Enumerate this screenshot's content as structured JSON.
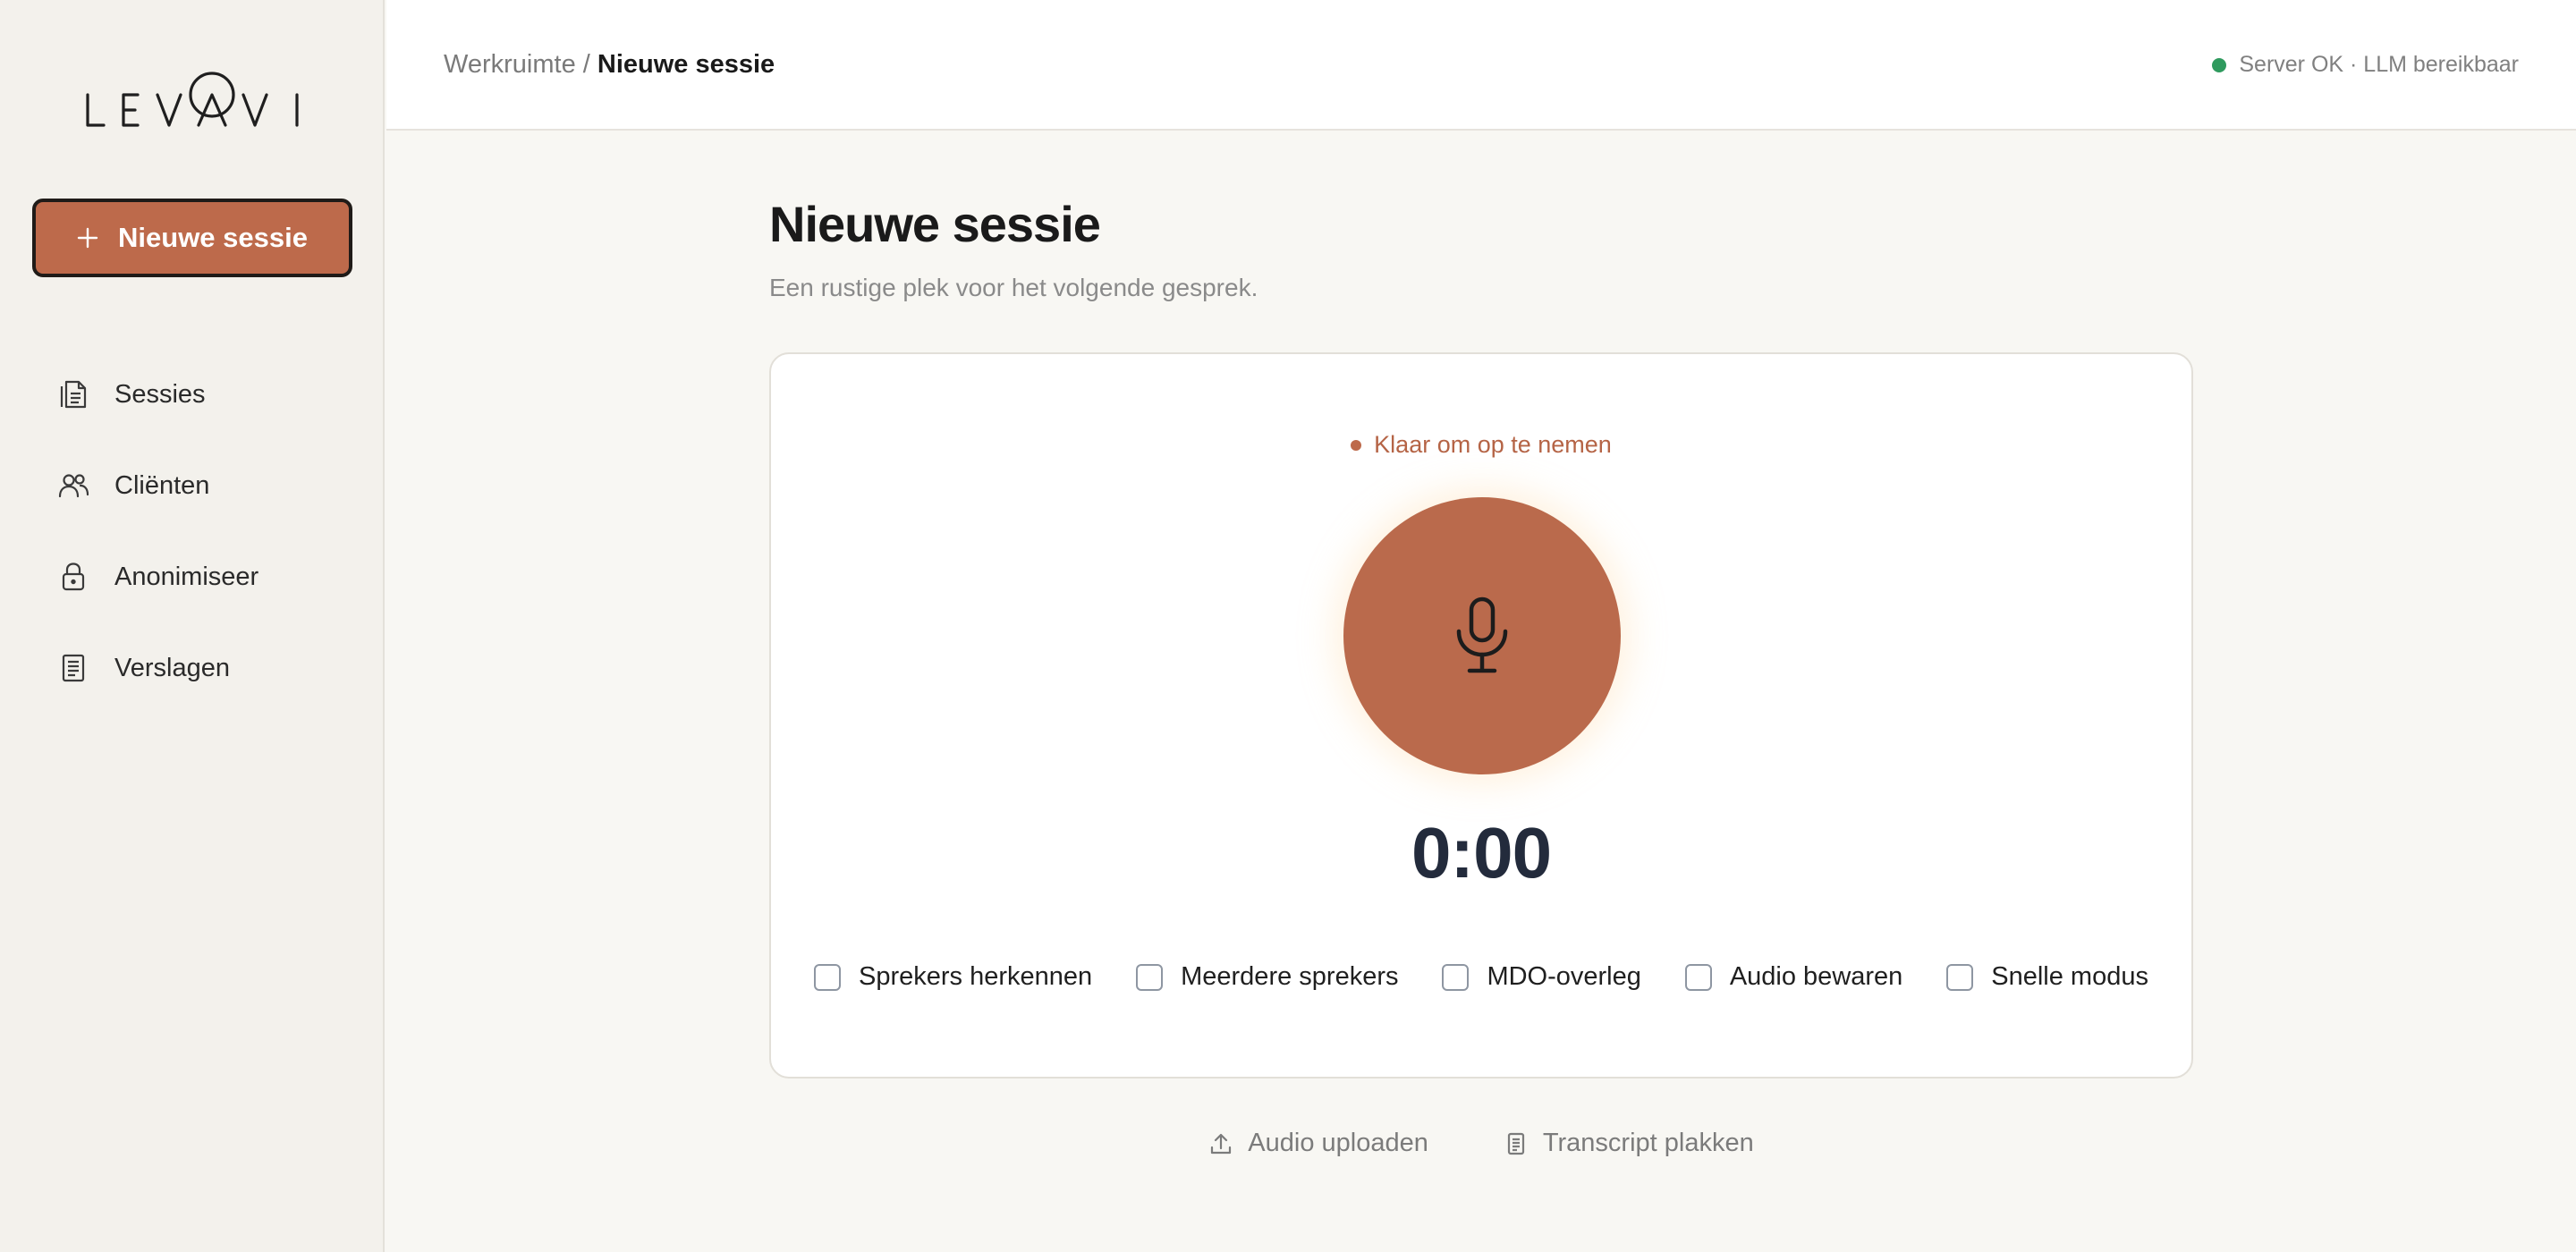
{
  "brand": {
    "logo_text": "LEVAVI",
    "accent": "#bd6a4b"
  },
  "sidebar": {
    "new_session_label": "Nieuwe sessie",
    "items": [
      {
        "label": "Sessies",
        "icon": "document-list-icon"
      },
      {
        "label": "Cliënten",
        "icon": "users-icon"
      },
      {
        "label": "Anonimiseer",
        "icon": "lock-icon"
      },
      {
        "label": "Verslagen",
        "icon": "report-icon"
      }
    ]
  },
  "topbar": {
    "breadcrumb_root": "Werkruimte /",
    "breadcrumb_current": "Nieuwe sessie",
    "status_text": "Server OK · LLM bereikbaar",
    "status_color": "#2f9a5e"
  },
  "main": {
    "title": "Nieuwe sessie",
    "subtitle": "Een rustige plek voor het volgende gesprek.",
    "recorder": {
      "status": "Klaar om op te nemen",
      "timer": "0:00",
      "record_color": "#ba6a4c"
    },
    "options": [
      {
        "label": "Sprekers herkennen",
        "checked": false
      },
      {
        "label": "Meerdere sprekers",
        "checked": false
      },
      {
        "label": "MDO-overleg",
        "checked": false
      },
      {
        "label": "Audio bewaren",
        "checked": false
      },
      {
        "label": "Snelle modus",
        "checked": false
      }
    ],
    "actions": {
      "upload_label": "Audio uploaden",
      "paste_label": "Transcript plakken"
    }
  }
}
